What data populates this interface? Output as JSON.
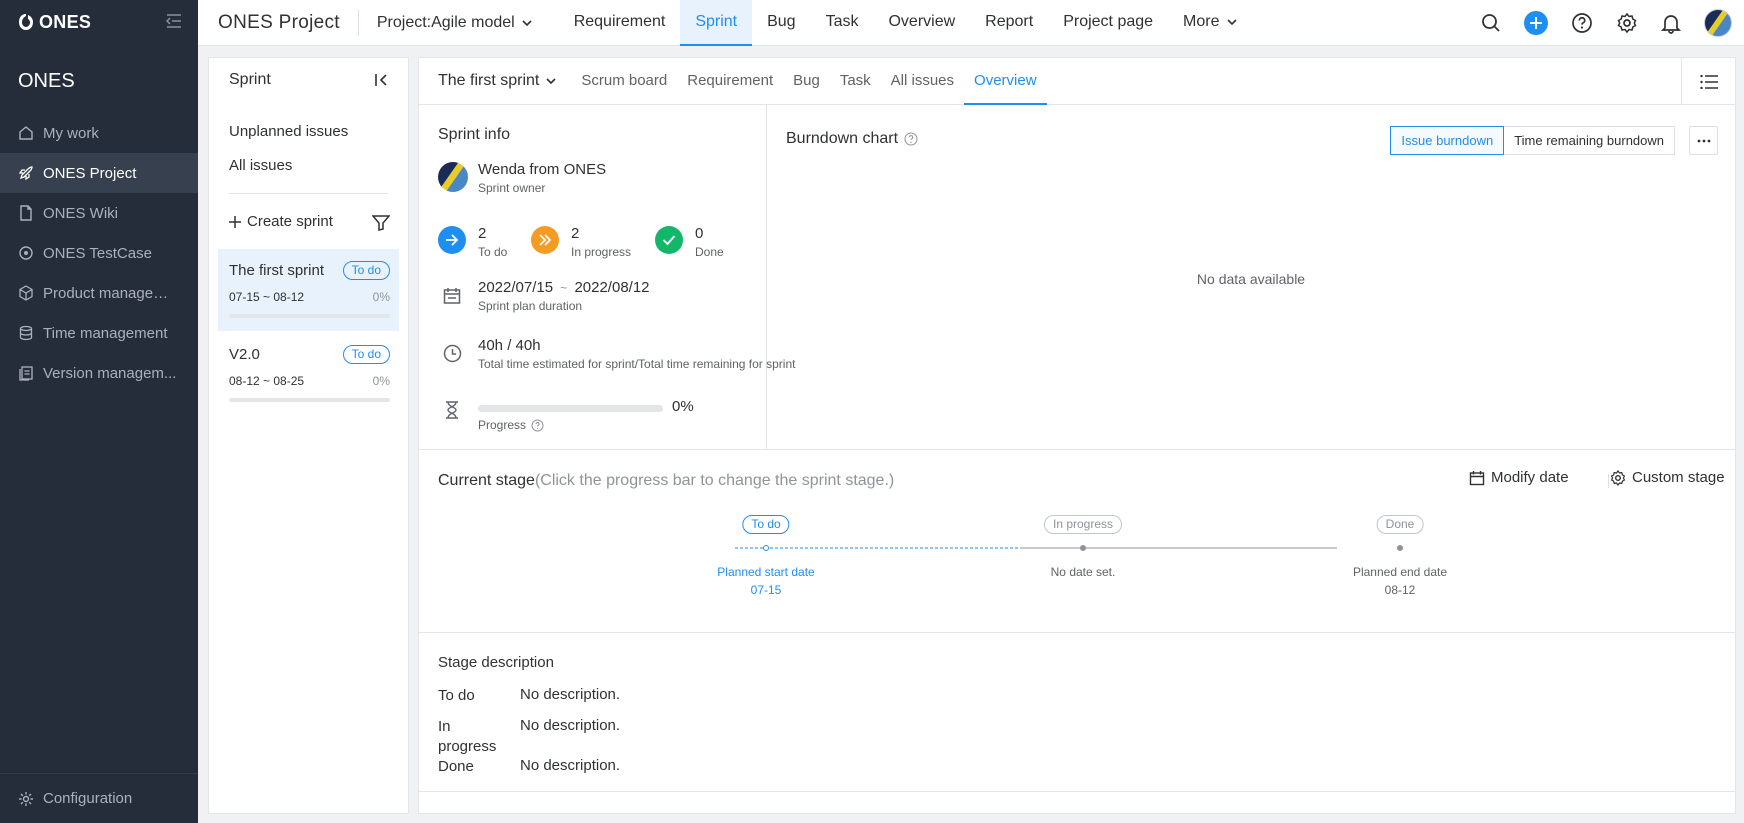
{
  "app": {
    "logo_text": "ONES",
    "workspace_title": "ONES"
  },
  "sidebar": {
    "items": [
      {
        "label": "My work",
        "icon": "home-icon"
      },
      {
        "label": "ONES Project",
        "icon": "rocket-icon",
        "active": true
      },
      {
        "label": "ONES Wiki",
        "icon": "document-icon"
      },
      {
        "label": "ONES TestCase",
        "icon": "testcase-icon"
      },
      {
        "label": "Product managem...",
        "icon": "cube-icon"
      },
      {
        "label": "Time management",
        "icon": "database-icon"
      },
      {
        "label": "Version managem...",
        "icon": "version-icon"
      }
    ],
    "config_label": "Configuration"
  },
  "topbar": {
    "brand": "ONES Project",
    "project_selector": "Project:Agile model",
    "nav": [
      "Requirement",
      "Sprint",
      "Bug",
      "Task",
      "Overview",
      "Report",
      "Project page",
      "More"
    ],
    "active_nav": "Sprint",
    "accent": "#1f8ef1"
  },
  "sprint_panel": {
    "title": "Sprint",
    "links": [
      "Unplanned issues",
      "All issues"
    ],
    "create_label": "Create sprint",
    "sprints": [
      {
        "name": "The first sprint",
        "status": "To do",
        "dates": "07-15 ~ 08-12",
        "percent": "0%",
        "progress": 0
      },
      {
        "name": "V2.0",
        "status": "To do",
        "dates": "08-12 ~ 08-25",
        "percent": "0%",
        "progress": 0
      }
    ]
  },
  "main": {
    "sprint_selector": "The first sprint",
    "tabs": [
      "Scrum board",
      "Requirement",
      "Bug",
      "Task",
      "All issues",
      "Overview"
    ],
    "active_tab": "Overview"
  },
  "sprint_info": {
    "title": "Sprint info",
    "owner_name": "Wenda from ONES",
    "owner_role": "Sprint owner",
    "counts": [
      {
        "value": "2",
        "label": "To do",
        "color": "#1f8ef1"
      },
      {
        "value": "2",
        "label": "In progress",
        "color": "#f59a23"
      },
      {
        "value": "0",
        "label": "Done",
        "color": "#12b76a"
      }
    ],
    "start_date": "2022/07/15",
    "date_sep": "~",
    "end_date": "2022/08/12",
    "duration_label": "Sprint plan duration",
    "time": "40h / 40h",
    "time_label": "Total time estimated for sprint/Total time remaining for sprint",
    "progress_pct": "0%",
    "progress": 0,
    "progress_label": "Progress"
  },
  "burndown": {
    "title": "Burndown chart",
    "buttons": [
      "Issue burndown",
      "Time remaining burndown"
    ],
    "active_button": "Issue burndown",
    "empty_text": "No data available"
  },
  "stage": {
    "title": "Current stage",
    "hint": "(Click the progress bar to change the sprint stage.)",
    "modify_date": "Modify date",
    "custom_stage": "Custom stage",
    "stages": [
      {
        "name": "To do",
        "line1": "Planned start date",
        "line2": "07-15",
        "active": true
      },
      {
        "name": "In progress",
        "line1": "No date set.",
        "line2": ""
      },
      {
        "name": "Done",
        "line1": "Planned end date",
        "line2": "08-12"
      }
    ]
  },
  "stage_description": {
    "title": "Stage description",
    "rows": [
      {
        "key": "To do",
        "value": "No description."
      },
      {
        "key": "In progress",
        "value": "No description."
      },
      {
        "key": "Done",
        "value": "No description."
      }
    ]
  }
}
